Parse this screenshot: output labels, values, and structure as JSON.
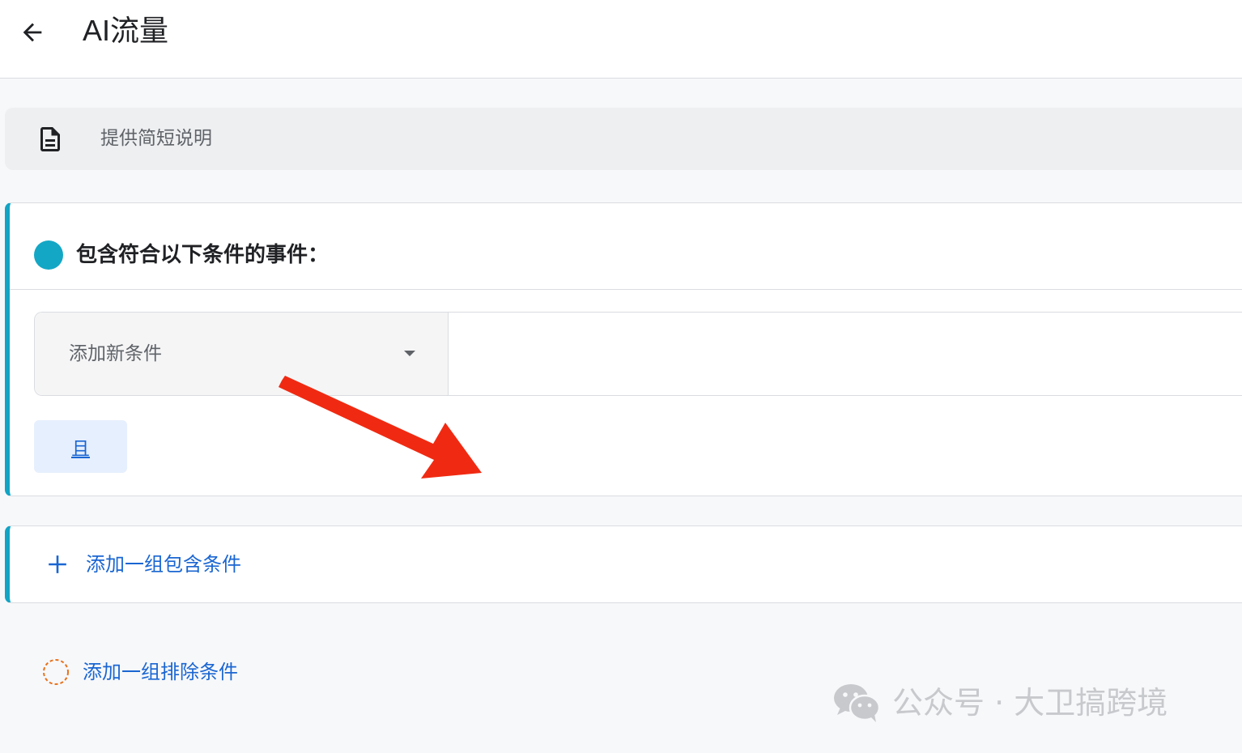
{
  "header": {
    "title": "AI流量",
    "back_icon": "arrow-left-icon"
  },
  "description": {
    "placeholder": "提供简短说明",
    "icon": "document-icon"
  },
  "include_group": {
    "title": "包含符合以下条件的事件：",
    "accent_color": "#12a4c4",
    "condition_select": {
      "value": "添加新条件"
    },
    "and_label": "且"
  },
  "add_include_group": {
    "label": "添加一组包含条件",
    "icon": "plus-icon"
  },
  "add_exclude_group": {
    "label": "添加一组排除条件",
    "icon": "dashed-circle-icon"
  },
  "annotation": {
    "icon": "red-arrow-icon",
    "color": "#f02a12"
  },
  "watermark": {
    "text": "公众号 · 大卫搞跨境",
    "icon": "wechat-icon"
  },
  "colors": {
    "link": "#1a66d2",
    "accent": "#12a4c4",
    "exclude": "#e8711a"
  }
}
